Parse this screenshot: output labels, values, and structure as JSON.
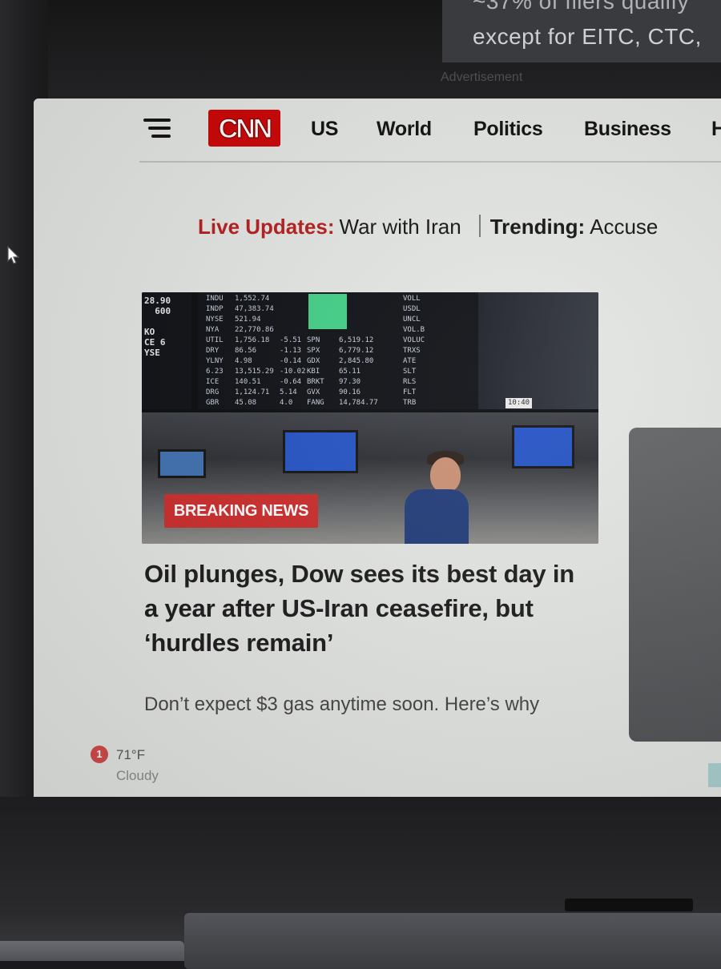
{
  "advertisement": {
    "line1": "~37% of filers qualify",
    "line2": "except for EITC, CTC,",
    "label": "Advertisement"
  },
  "nav": {
    "logo": "CNN",
    "items": [
      "US",
      "World",
      "Politics",
      "Business",
      "H"
    ]
  },
  "live_bar": {
    "live_label": "Live Updates:",
    "live_text": "War with Iran",
    "trending_label": "Trending:",
    "trending_text": "Accuse"
  },
  "hero": {
    "badge": "BREAKING NEWS",
    "headline": "Oil plunges, Dow sees its best day in a year after US-Iran ceasefire, but ‘hurdles remain’",
    "subheadline": "Don’t expect $3 gas anytime soon. Here’s why",
    "board_left": "28.90\n  600\n\nKO\nCE 6\nYSE",
    "board_col1": "INDU\nINDP\nNYSE\nNYA\nUTIL\nDRY\nYLNY\n6.23\nICE\nDRG\nGBR",
    "board_col2": "1,552.74\n47,383.74\n521.94\n22,770.86\n1,756.18\n86.56\n4.98\n13,515.29\n140.51\n1,124.71\n45.08",
    "board_col3": "\n\n\n\n-5.51\n-1.13\n-0.14\n-10.02\n-0.64\n5.14\n4.0",
    "board_col4": "\n\n\n\nSPN\nSPX\nGDX\nKBI\nBRKT\nGVX\nFANG",
    "board_col5": "\n\n\n\n6,519.12\n6,779.12\n2,845.80\n65.11\n97.30\n90.16\n14,784.77",
    "board_col6": "VOLL\nUSDL\nUNCL\nVOL.B\nVOLUC\nTRXS\nATE\nSLT\nRLS\nFLT\nTRB",
    "board_clock": "10:40"
  },
  "weather": {
    "alert_count": "1",
    "temp": "71°F",
    "condition": "Cloudy"
  }
}
